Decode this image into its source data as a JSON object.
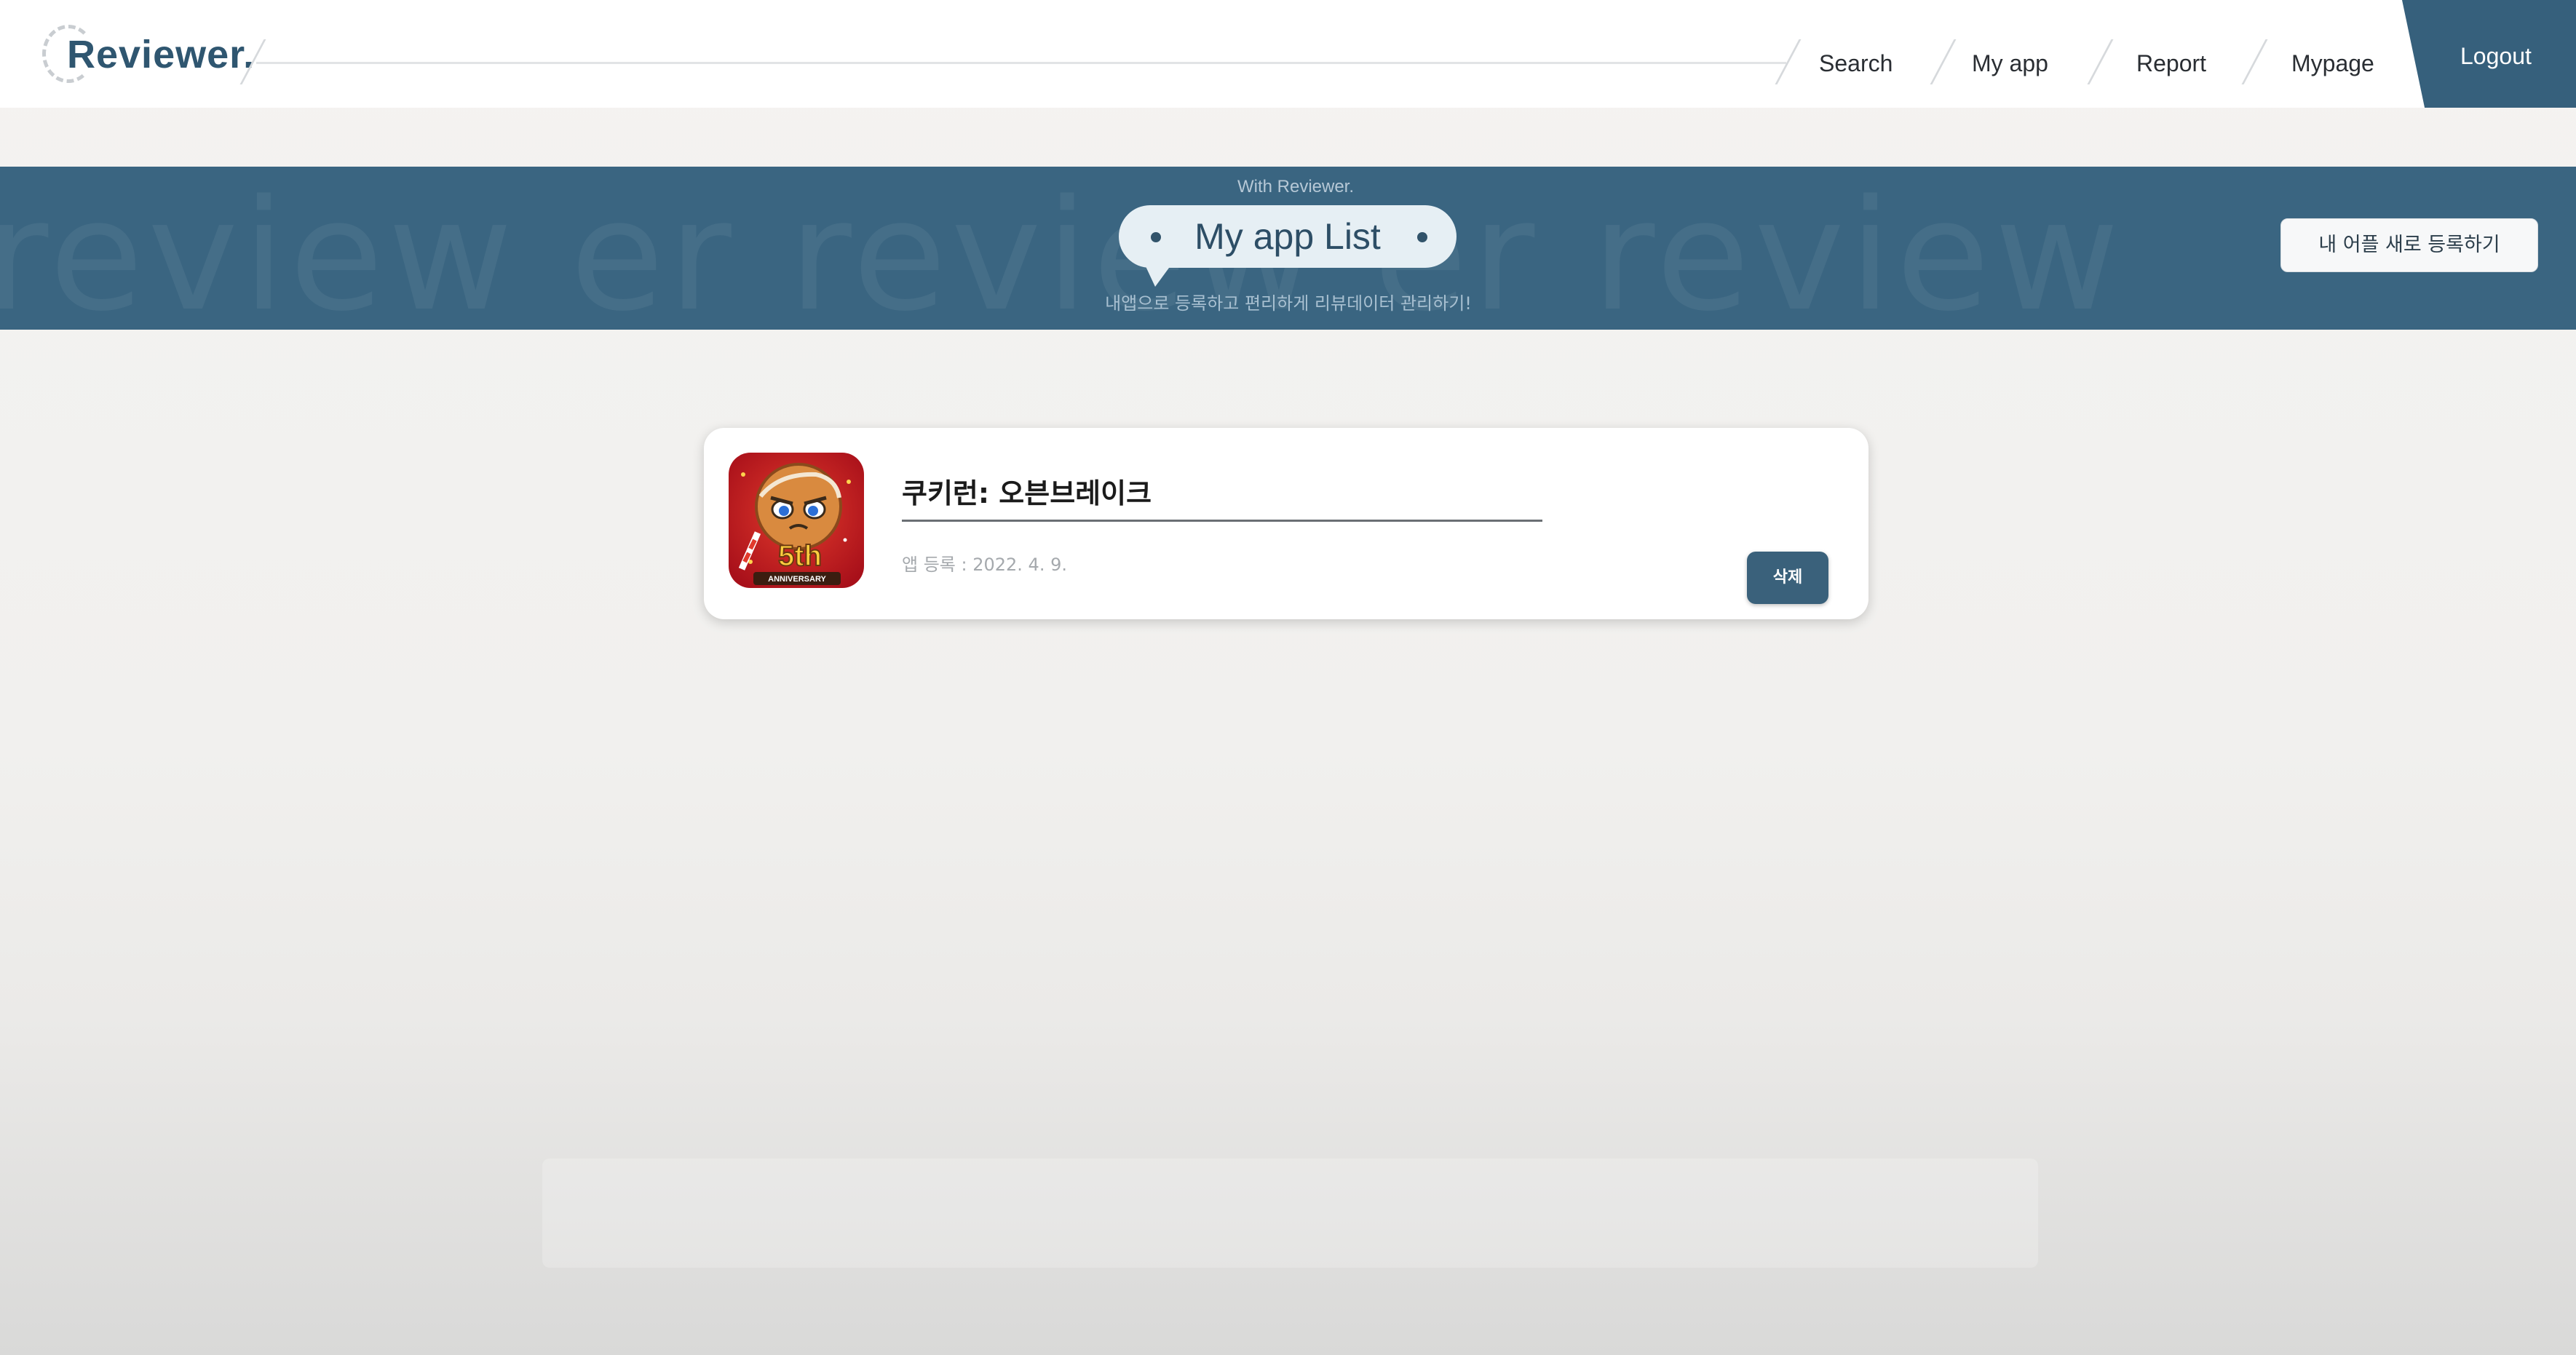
{
  "header": {
    "logo_text": "Reviewer.",
    "nav": [
      {
        "label": "Search"
      },
      {
        "label": "My app"
      },
      {
        "label": "Report"
      },
      {
        "label": "Mypage"
      }
    ],
    "logout_label": "Logout"
  },
  "banner": {
    "kicker": "With Reviewer.",
    "title": "My app List",
    "subtitle": "내앱으로 등록하고 편리하게 리뷰데이터 관리하기!",
    "watermark": "review   er review   er review",
    "register_button": "내 어플 새로 등록하기"
  },
  "apps": [
    {
      "name": "쿠키런: 오븐브레이크",
      "registered": "앱 등록 : 2022. 4. 9.",
      "delete_label": "삭제",
      "icon": "cookie-run-app-icon",
      "icon_badge": "5th",
      "icon_badge_sub": "ANNIVERSARY"
    }
  ],
  "colors": {
    "primary": "#3a6581",
    "logo": "#2f5670",
    "background": "#f2f1ef",
    "icon_red": "#c61a1f"
  }
}
